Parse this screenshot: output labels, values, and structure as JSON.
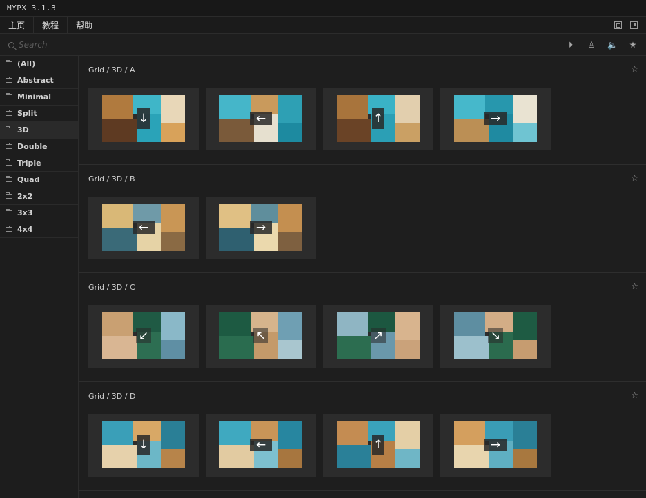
{
  "app": {
    "title": "MYPX 3.1.3"
  },
  "menu": [
    "主页",
    "教程",
    "帮助"
  ],
  "search": {
    "placeholder": "Search"
  },
  "toolbar_icons": [
    "play-icon",
    "brush-icon",
    "volume-icon",
    "star-filled-icon"
  ],
  "sidebar": {
    "active_index": 4,
    "items": [
      "(All)",
      "Abstract",
      "Minimal",
      "Split",
      "3D",
      "Double",
      "Triple",
      "Quad",
      "2x2",
      "3x3",
      "4x4"
    ]
  },
  "sections": [
    {
      "title": "Grid / 3D / A",
      "presets": [
        {
          "arrow": "↓",
          "dir": "v",
          "palette": [
            "#b07a3e",
            "#3fb6c8",
            "#e8d7b8",
            "#5e3a22",
            "#2aa3b8",
            "#d8a25a"
          ]
        },
        {
          "arrow": "←",
          "dir": "h",
          "palette": [
            "#45b6c9",
            "#c99a5c",
            "#2ea0b4",
            "#7a5a3a",
            "#e6e0cf",
            "#1d8aa0"
          ]
        },
        {
          "arrow": "↑",
          "dir": "v",
          "palette": [
            "#a8743c",
            "#3ab2c6",
            "#e2cfae",
            "#6a4326",
            "#2b9fb5",
            "#caa064"
          ]
        },
        {
          "arrow": "→",
          "dir": "h",
          "palette": [
            "#46b8cb",
            "#2797ad",
            "#e9e3d2",
            "#bb8f55",
            "#1f8aa1",
            "#6fc4d2"
          ]
        }
      ]
    },
    {
      "title": "Grid / 3D / B",
      "presets": [
        {
          "arrow": "←",
          "dir": "h",
          "palette": [
            "#d9b877",
            "#6f9aa8",
            "#c99655",
            "#3a6a78",
            "#e6d3a6",
            "#8a6a44"
          ]
        },
        {
          "arrow": "→",
          "dir": "h",
          "palette": [
            "#e0c084",
            "#5f8e9c",
            "#c48f50",
            "#2f6070",
            "#ebd9ad",
            "#7e6040"
          ]
        }
      ]
    },
    {
      "title": "Grid / 3D / C",
      "presets": [
        {
          "arrow": "↙",
          "dir": "d",
          "palette": [
            "#c9a072",
            "#1f5a44",
            "#8ab8c8",
            "#d9b693",
            "#2d6e52",
            "#5f8fa4"
          ]
        },
        {
          "arrow": "↖",
          "dir": "d",
          "palette": [
            "#1d5a42",
            "#d6b48c",
            "#6f9fb3",
            "#2a6c4f",
            "#c49a6a",
            "#a9c6cf"
          ]
        },
        {
          "arrow": "↗",
          "dir": "d",
          "palette": [
            "#8fb5c3",
            "#1c5740",
            "#d8b48e",
            "#2c6d50",
            "#6a98ab",
            "#caa27a"
          ]
        },
        {
          "arrow": "↘",
          "dir": "d",
          "palette": [
            "#5e8ea1",
            "#d3ad86",
            "#1e5b43",
            "#9cc0cc",
            "#2b6b4e",
            "#c69c70"
          ]
        }
      ]
    },
    {
      "title": "Grid / 3D / D",
      "presets": [
        {
          "arrow": "↓",
          "dir": "v",
          "palette": [
            "#3a9fb8",
            "#d8a866",
            "#2a7f96",
            "#e6d1ab",
            "#6cb7c7",
            "#b7844a"
          ]
        },
        {
          "arrow": "←",
          "dir": "h",
          "palette": [
            "#3fa9c0",
            "#c99558",
            "#2786a0",
            "#e2cba1",
            "#7dc0cf",
            "#a7763f"
          ]
        },
        {
          "arrow": "↑",
          "dir": "v",
          "palette": [
            "#c48c52",
            "#3aa3bb",
            "#e4cfa6",
            "#2a8098",
            "#b77f46",
            "#6fb6c6"
          ]
        },
        {
          "arrow": "→",
          "dir": "h",
          "palette": [
            "#d49f5e",
            "#3a9db6",
            "#2a7f96",
            "#e8d5ae",
            "#5fafc2",
            "#a8783f"
          ]
        }
      ]
    }
  ]
}
